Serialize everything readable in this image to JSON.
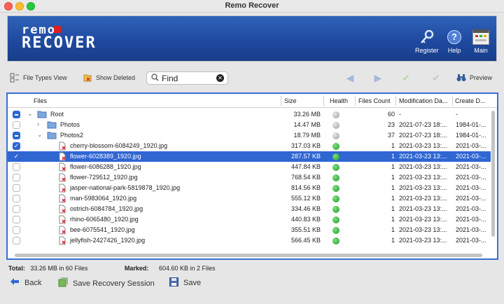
{
  "window": {
    "title": "Remo Recover"
  },
  "brand": {
    "line1": "remo",
    "line2": "RECOVER"
  },
  "header_buttons": {
    "register": "Register",
    "help": "Help",
    "main": "Main"
  },
  "toolbar": {
    "file_types_view": "File Types View",
    "show_deleted": "Show Deleted",
    "search_value": "Find",
    "preview": "Preview"
  },
  "table": {
    "columns": {
      "files": "Files",
      "size": "Size",
      "health": "Health",
      "count": "Files Count",
      "modified": "Modification Da...",
      "created": "Create D..."
    },
    "rows": [
      {
        "name": "Root",
        "size": "33.26 MB",
        "health": "gray",
        "count": "60",
        "modified": "-",
        "created": "-",
        "check": "mixed",
        "level": 0,
        "type": "folder",
        "expand": "open"
      },
      {
        "name": "Photos",
        "size": "14.47 MB",
        "health": "gray",
        "count": "23",
        "modified": "2021-07-23 18:...",
        "created": "1984-01-...",
        "check": "off",
        "level": 1,
        "type": "folder",
        "expand": "closed"
      },
      {
        "name": "Photos2",
        "size": "18.79 MB",
        "health": "gray",
        "count": "37",
        "modified": "2021-07-23 18:...",
        "created": "1984-01-...",
        "check": "mixed",
        "level": 1,
        "type": "folder",
        "expand": "open"
      },
      {
        "name": "cherry-blossom-6084249_1920.jpg",
        "size": "317.03 KB",
        "health": "green",
        "count": "1",
        "modified": "2021-03-23 13:...",
        "created": "2021-03-...",
        "check": "on",
        "level": 2,
        "type": "file"
      },
      {
        "name": "flower-6028389_1920.jpg",
        "size": "287.57 KB",
        "health": "green",
        "count": "1",
        "modified": "2021-03-23 13:...",
        "created": "2021-03-...",
        "check": "on",
        "level": 2,
        "type": "file",
        "selected": true
      },
      {
        "name": "flower-6086288_1920.jpg",
        "size": "447.84 KB",
        "health": "green",
        "count": "1",
        "modified": "2021-03-23 13:...",
        "created": "2021-03-...",
        "check": "off",
        "level": 2,
        "type": "file"
      },
      {
        "name": "flower-729512_1920.jpg",
        "size": "768.54 KB",
        "health": "green",
        "count": "1",
        "modified": "2021-03-23 13:...",
        "created": "2021-03-...",
        "check": "off",
        "level": 2,
        "type": "file"
      },
      {
        "name": "jasper-national-park-5819878_1920.jpg",
        "size": "814.56 KB",
        "health": "green",
        "count": "1",
        "modified": "2021-03-23 13:...",
        "created": "2021-03-...",
        "check": "off",
        "level": 2,
        "type": "file"
      },
      {
        "name": "man-5983064_1920.jpg",
        "size": "555.12 KB",
        "health": "green",
        "count": "1",
        "modified": "2021-03-23 13:...",
        "created": "2021-03-...",
        "check": "off",
        "level": 2,
        "type": "file"
      },
      {
        "name": "ostrich-6084784_1920.jpg",
        "size": "334.46 KB",
        "health": "green",
        "count": "1",
        "modified": "2021-03-23 13:...",
        "created": "2021-03-...",
        "check": "off",
        "level": 2,
        "type": "file"
      },
      {
        "name": "rhino-6065480_1920.jpg",
        "size": "440.83 KB",
        "health": "green",
        "count": "1",
        "modified": "2021-03-23 13:...",
        "created": "2021-03-...",
        "check": "off",
        "level": 2,
        "type": "file"
      },
      {
        "name": "bee-6075541_1920.jpg",
        "size": "355.51 KB",
        "health": "green",
        "count": "1",
        "modified": "2021-03-23 13:...",
        "created": "2021-03-...",
        "check": "off",
        "level": 2,
        "type": "file"
      },
      {
        "name": "jellyfish-2427426_1920.jpg",
        "size": "566.45 KB",
        "health": "green",
        "count": "1",
        "modified": "2021-03-23 13:...",
        "created": "2021-03-...",
        "check": "off",
        "level": 2,
        "type": "file"
      }
    ]
  },
  "status": {
    "total_label": "Total:",
    "total_value": "33.26 MB in 60 Files",
    "marked_label": "Marked:",
    "marked_value": "604.60 KB in 2 Files"
  },
  "bottom": {
    "back": "Back",
    "save_session": "Save Recovery Session",
    "save": "Save"
  },
  "colors": {
    "accent": "#2f66d2",
    "banner": "#1f4aa0",
    "health_ok": "#1e9a2c"
  }
}
